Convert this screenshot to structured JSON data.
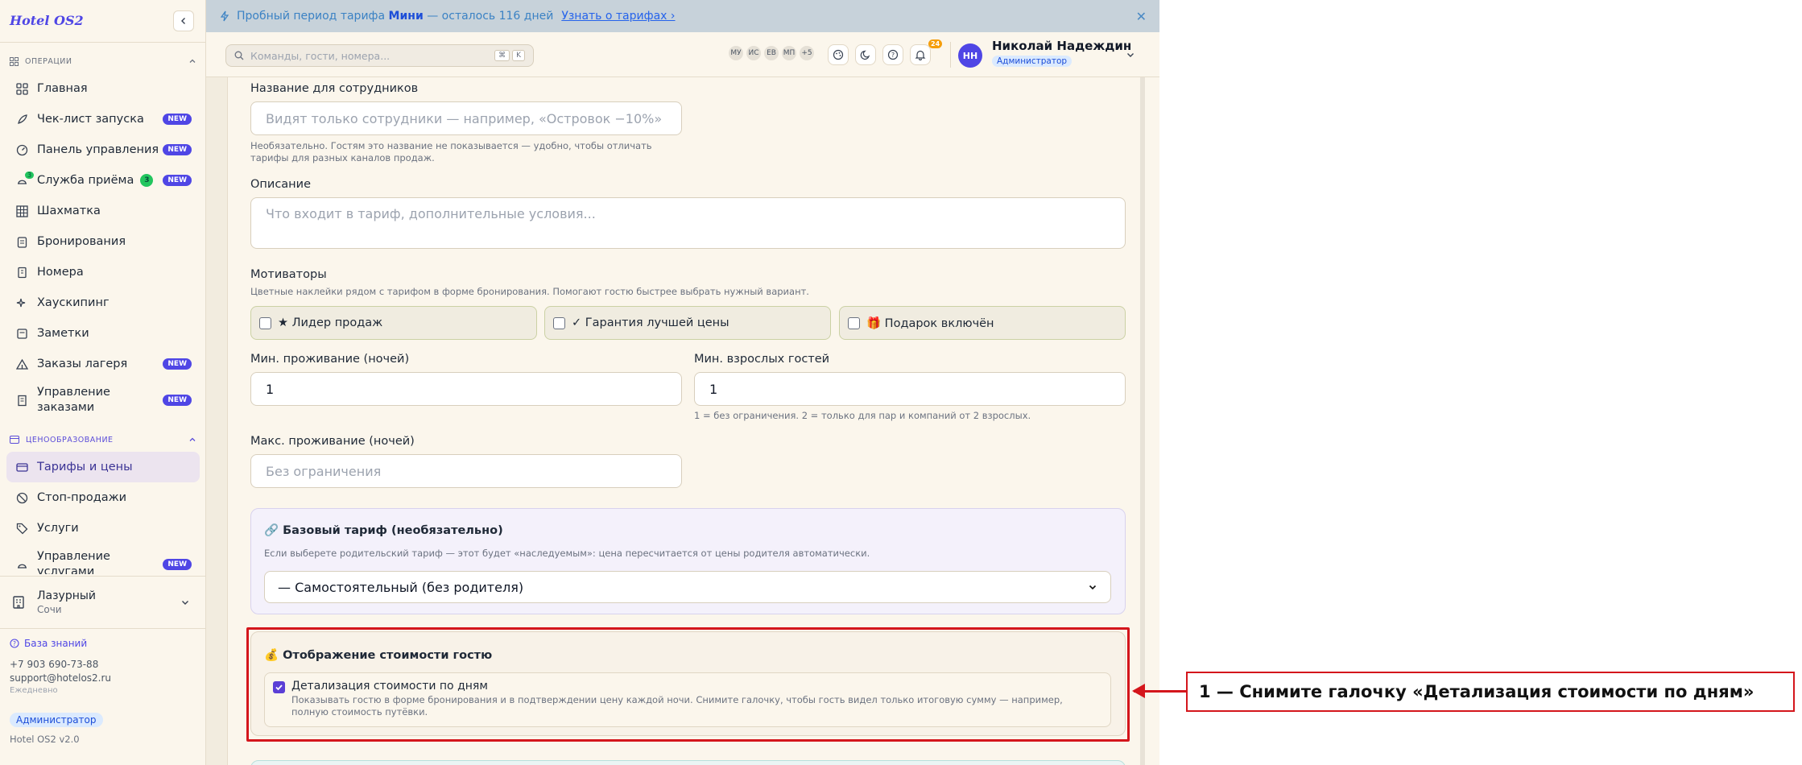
{
  "app": {
    "logo": "Hotel OS2"
  },
  "banner": {
    "prefix": "Пробный период тарифа",
    "plan": "Мини",
    "suffix": "— осталось 116 дней",
    "link": "Узнать о тарифах ›"
  },
  "search": {
    "placeholder": "Команды, гости, номера...",
    "key1": "⌘",
    "key2": "K"
  },
  "team": [
    "МУ",
    "ИС",
    "ЕВ",
    "МП",
    "+5"
  ],
  "notifications": {
    "count": "24"
  },
  "user": {
    "initials": "НН",
    "name": "Николай Надеждин",
    "role": "Администратор"
  },
  "sidebar": {
    "sections": [
      {
        "label": "ОПЕРАЦИИ"
      },
      {
        "label": "ЦЕНООБРАЗОВАНИЕ"
      }
    ],
    "ops_items": [
      {
        "label": "Главная"
      },
      {
        "label": "Чек-лист запуска",
        "badge": "NEW"
      },
      {
        "label": "Панель управления",
        "badge": "NEW"
      },
      {
        "label": "Служба приёма",
        "count": "3",
        "mini": "3",
        "badge": "NEW"
      },
      {
        "label": "Шахматка"
      },
      {
        "label": "Бронирования"
      },
      {
        "label": "Номера"
      },
      {
        "label": "Хаускипинг"
      },
      {
        "label": "Заметки"
      },
      {
        "label": "Заказы лагеря",
        "badge": "NEW"
      },
      {
        "label": "Управление заказами",
        "badge": "NEW"
      }
    ],
    "pricing_items": [
      {
        "label": "Тарифы и цены"
      },
      {
        "label": "Стоп-продажи"
      },
      {
        "label": "Услуги"
      },
      {
        "label": "Управление услугами",
        "badge": "NEW"
      }
    ],
    "property": {
      "name": "Лазурный",
      "city": "Сочи"
    },
    "footer": {
      "kb": "База знаний",
      "phone": "+7 903 690-73-88",
      "email": "support@hotelos2.ru",
      "freq": "Ежедневно",
      "role": "Администратор",
      "version": "Hotel OS2 v2.0"
    }
  },
  "form": {
    "staff_name": {
      "label": "Название для сотрудников",
      "placeholder": "Видят только сотрудники — например, «Островок −10%»",
      "hint": "Необязательно. Гостям это название не показывается — удобно, чтобы отличать тарифы для разных каналов продаж."
    },
    "description": {
      "label": "Описание",
      "placeholder": "Что входит в тариф, дополнительные условия..."
    },
    "motivators": {
      "label": "Мотиваторы",
      "hint": "Цветные наклейки рядом с тарифом в форме бронирования. Помогают гостю быстрее выбрать нужный вариант.",
      "items": [
        "★ Лидер продаж",
        "✓ Гарантия лучшей цены",
        "🎁 Подарок включён"
      ]
    },
    "min_stay": {
      "label": "Мин. проживание (ночей)",
      "value": "1"
    },
    "min_adults": {
      "label": "Мин. взрослых гостей",
      "value": "1",
      "hint": "1 = без ограничения. 2 = только для пар и компаний от 2 взрослых."
    },
    "max_stay": {
      "label": "Макс. проживание (ночей)",
      "placeholder": "Без ограничения"
    },
    "base_rate": {
      "title": "🔗 Базовый тариф (необязательно)",
      "hint": "Если выберете родительский тариф — этот будет «наследуемым»: цена пересчитается от цены родителя автоматически.",
      "selected": "— Самостоятельный (без родителя)"
    },
    "price_display": {
      "title": "💰 Отображение стоимости гостю",
      "checkbox_label": "Детализация стоимости по дням",
      "checkbox_hint": "Показывать гостю в форме бронирования и в подтверждении цену каждой ночи. Снимите галочку, чтобы гость видел только итоговую сумму — например, полную стоимость путёвки.",
      "checked": true
    }
  },
  "annotation": {
    "text": "1 — Снимите галочку «Детализация стоимости по дням»"
  },
  "colors": {
    "accent": "#4f46e5",
    "highlight": "#d4161c",
    "badge_new": "#4f46e5"
  }
}
